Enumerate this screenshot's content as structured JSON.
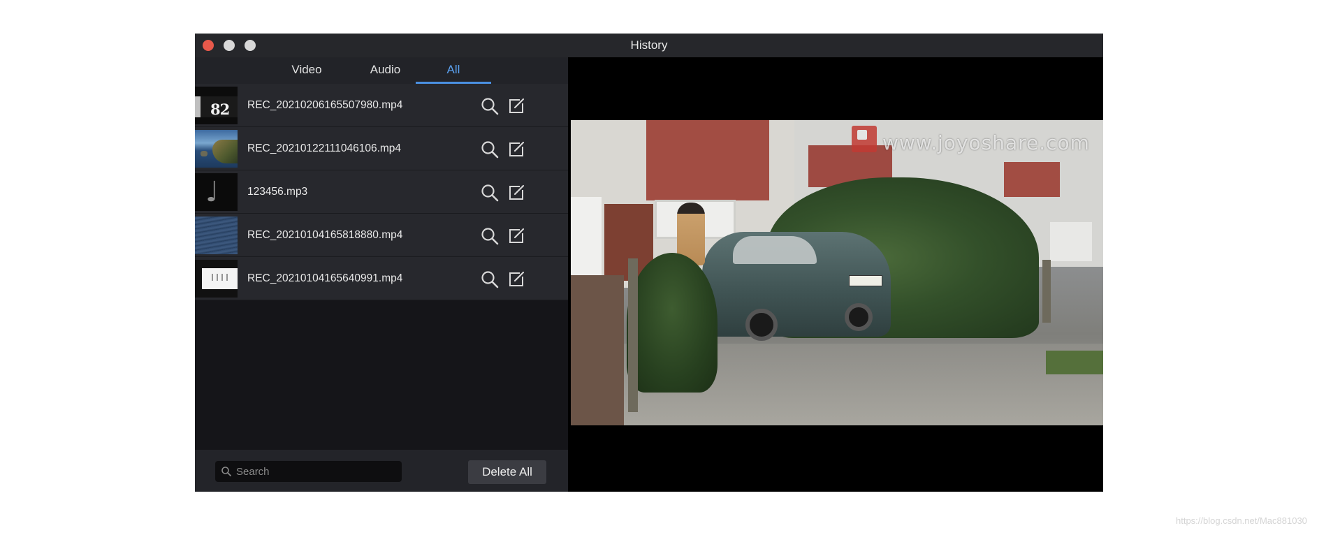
{
  "window": {
    "title": "History"
  },
  "tabs": [
    {
      "label": "Video",
      "active": false
    },
    {
      "label": "Audio",
      "active": false
    },
    {
      "label": "All",
      "active": true
    }
  ],
  "files": [
    {
      "name": "REC_20210206165507980.mp4",
      "thumb_text": "82"
    },
    {
      "name": "REC_20210122111046106.mp4"
    },
    {
      "name": "123456.mp3",
      "thumb_icon": "music-note-icon"
    },
    {
      "name": "REC_20210104165818880.mp4"
    },
    {
      "name": "REC_20210104165640991.mp4"
    }
  ],
  "row_icons": [
    "search-icon",
    "edit-icon"
  ],
  "bottom": {
    "search_placeholder": "Search",
    "delete_all_label": "Delete All"
  },
  "preview": {
    "watermark": "www.joyoshare.com"
  },
  "footer_watermark": "https://blog.csdn.net/Mac881030",
  "colors": {
    "accent": "#4a90e2",
    "close": "#e8594b",
    "panel": "#151519",
    "row": "#27282d"
  }
}
